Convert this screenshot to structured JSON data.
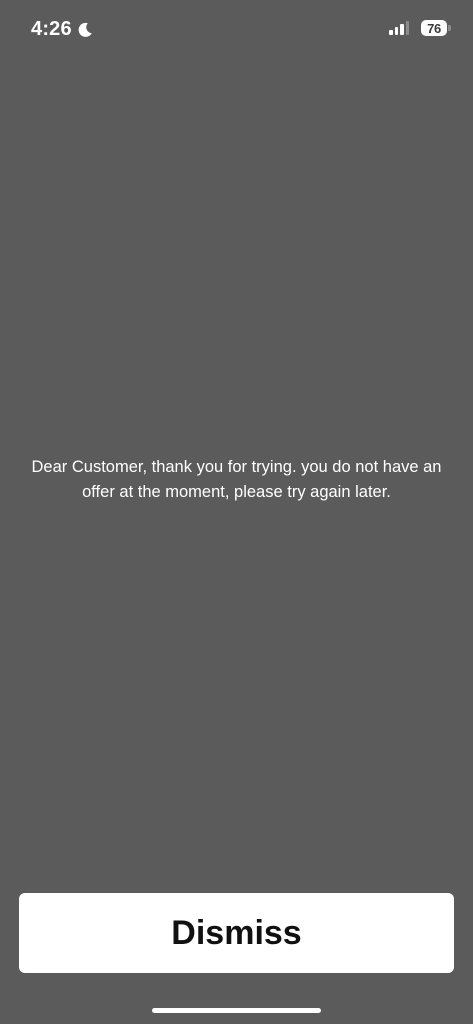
{
  "status_bar": {
    "time": "4:26",
    "battery_level": "76",
    "signal_bars_active": 3,
    "icons": [
      "moon-icon",
      "signal-icon",
      "battery-icon"
    ]
  },
  "message": {
    "text": "Dear Customer, thank you for trying. you do not have an offer at the moment, please try again later."
  },
  "dismiss": {
    "label": "Dismiss"
  },
  "colors": {
    "background": "#5b5b5b",
    "button_background": "#ffffff",
    "button_text": "#111111",
    "text": "#ffffff"
  }
}
